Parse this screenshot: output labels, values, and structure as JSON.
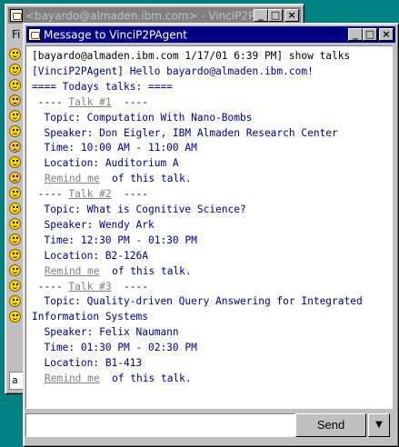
{
  "back_window": {
    "title": "<bayardo@almaden.ibm.com> - VinciP2P",
    "menu_partial": "Fi",
    "input_partial": "a",
    "buttons": {
      "minimize": "_",
      "maximize": "□",
      "close": "×"
    }
  },
  "front_window": {
    "title": "Message to VinciP2PAgent",
    "buttons": {
      "minimize": "_",
      "maximize": "□",
      "close": "×"
    }
  },
  "contacts": [
    {
      "status": "online"
    },
    {
      "status": "online"
    },
    {
      "status": "online"
    },
    {
      "status": "away"
    },
    {
      "status": "online"
    },
    {
      "status": "online"
    },
    {
      "status": "away"
    },
    {
      "status": "online"
    },
    {
      "status": "away"
    },
    {
      "status": "online"
    },
    {
      "status": "online"
    },
    {
      "status": "online"
    },
    {
      "status": "online"
    },
    {
      "status": "online"
    },
    {
      "status": "online"
    },
    {
      "status": "online"
    },
    {
      "status": "online"
    },
    {
      "status": "online"
    }
  ],
  "chat": {
    "lines": [
      {
        "text": "[bayardo@almaden.ibm.com 1/17/01 6:39 PM] show talks",
        "style": "black"
      },
      {
        "text": "[VinciP2PAgent] Hello bayardo@almaden.ibm.com!",
        "style": "blue"
      },
      {
        "text": "==== Todays talks: ====",
        "style": "blue"
      }
    ],
    "talks": [
      {
        "header_pre": " ---- ",
        "link": "Talk #1",
        "header_post": "  ----",
        "topic": "  Topic: Computation With Nano-Bombs",
        "topic_cont": "",
        "speaker": "  Speaker: Don Eigler, IBM Almaden Research Center",
        "time": "  Time: 10:00 AM - 11:00 AM",
        "location": "  Location: Auditorium A",
        "remind_link": "Remind me",
        "remind_post": "  of this talk."
      },
      {
        "header_pre": " ---- ",
        "link": "Talk #2",
        "header_post": "  ----",
        "topic": "  Topic: What is Cognitive Science?",
        "topic_cont": "",
        "speaker": "  Speaker: Wendy Ark",
        "time": "  Time: 12:30 PM - 01:30 PM",
        "location": "  Location: B2-126A",
        "remind_link": "Remind me",
        "remind_post": "  of this talk."
      },
      {
        "header_pre": " ---- ",
        "link": "Talk #3",
        "header_post": "  ----",
        "topic": "  Topic: Quality-driven Query Answering for Integrated",
        "topic_cont": "Information Systems",
        "speaker": "  Speaker: Felix Naumann",
        "time": "  Time: 01:30 PM - 02:30 PM",
        "location": "  Location: B1-413",
        "remind_link": "Remind me",
        "remind_post": "  of this talk."
      }
    ]
  },
  "composer": {
    "input_value": "",
    "send_label": "Send",
    "dropdown_icon": "▼"
  }
}
